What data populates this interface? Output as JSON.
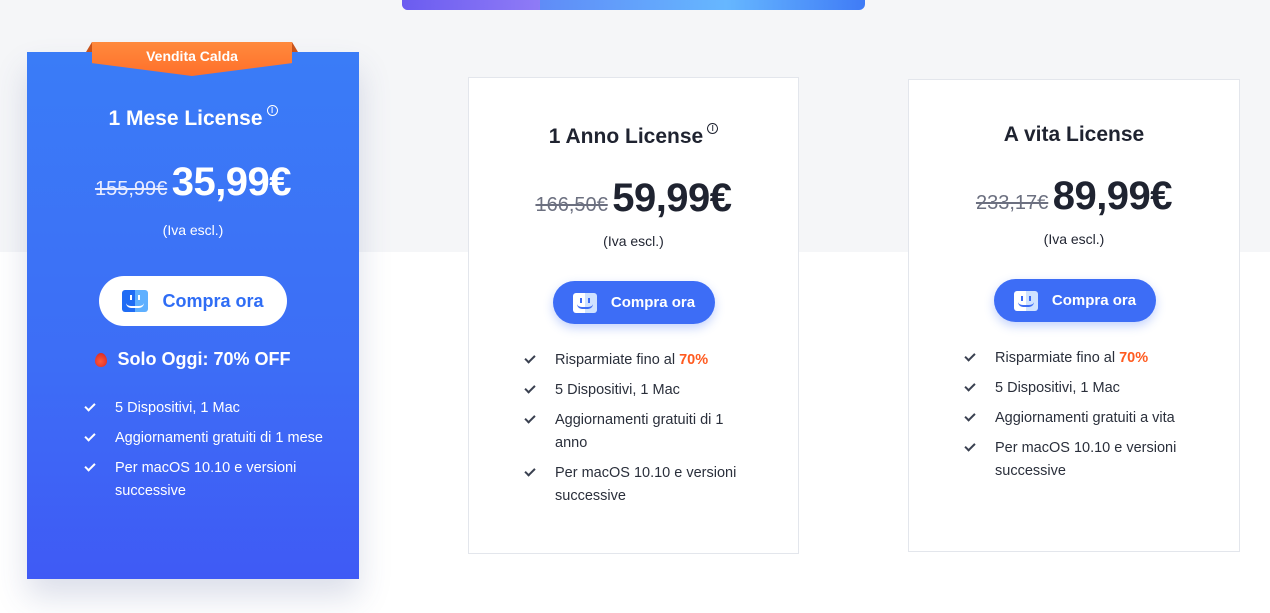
{
  "plans": [
    {
      "badge": "Vendita Calda",
      "title": "1 Mese License",
      "info_icon": "ⓘ",
      "old_price": "155,99€",
      "price": "35,99€",
      "tax_note": "(Iva escl.)",
      "button_label": "Compra ora",
      "offer": "Solo Oggi: 70% OFF",
      "features": [
        "5 Dispositivi, 1 Mac",
        "Aggiornamenti gratuiti di 1 mese",
        "Per macOS 10.10 e versioni successive"
      ]
    },
    {
      "title": "1 Anno License",
      "info_icon": "ⓘ",
      "old_price": "166,50€",
      "price": "59,99€",
      "tax_note": "(Iva escl.)",
      "button_label": "Compra ora",
      "savings_text": "Risparmiate fino al ",
      "savings_value": "70%",
      "features": [
        "5 Dispositivi, 1 Mac",
        "Aggiornamenti gratuiti di 1 anno",
        "Per macOS 10.10 e versioni successive"
      ]
    },
    {
      "title": "A vita License",
      "old_price": "233,17€",
      "price": "89,99€",
      "tax_note": "(Iva escl.)",
      "button_label": "Compra ora",
      "savings_text": "Risparmiate fino al ",
      "savings_value": "70%",
      "features": [
        "5 Dispositivi, 1 Mac",
        "Aggiornamenti gratuiti a vita",
        "Per macOS 10.10 e versioni successive"
      ]
    }
  ],
  "colors": {
    "primary_blue": "#3d6df6",
    "ribbon_orange": "#ff7a2f",
    "highlight_orange": "#ff5a1f",
    "page_bg": "#f5f6f8"
  },
  "icons": {
    "button_icon": "finder-icon",
    "offer_icon": "flame-icon",
    "feature_icon": "check-icon"
  }
}
